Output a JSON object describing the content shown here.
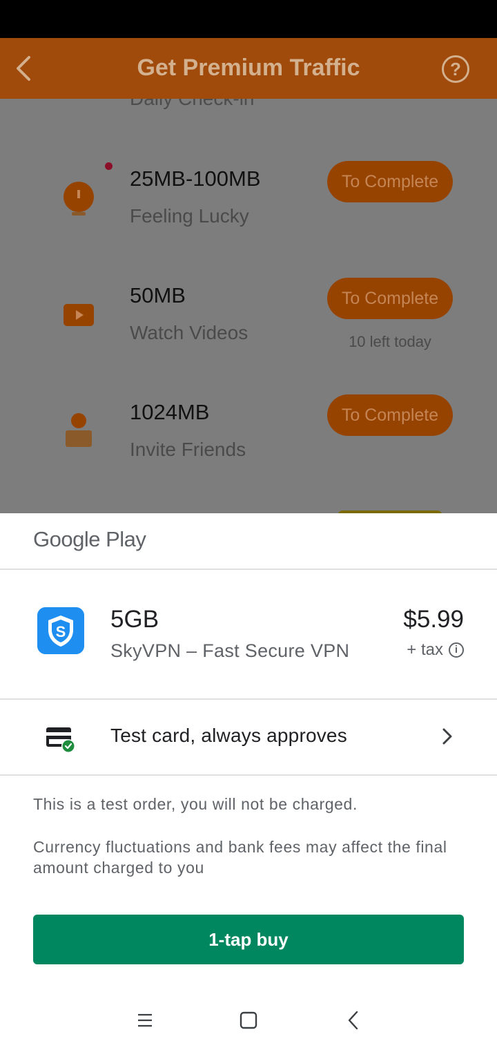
{
  "app": {
    "title": "Get Premium Traffic",
    "help_label": "?",
    "cut_off_section": "Daily Check-in",
    "tasks": [
      {
        "amount": "25MB-100MB",
        "description": "Feeling Lucky",
        "button": "To Complete",
        "note": ""
      },
      {
        "amount": "50MB",
        "description": "Watch Videos",
        "button": "To Complete",
        "note": "10 left today"
      },
      {
        "amount": "1024MB",
        "description": "Invite Friends",
        "button": "To Complete",
        "note": ""
      }
    ]
  },
  "sheet": {
    "brand": "Google Play",
    "product_name": "5GB",
    "product_app": "SkyVPN – Fast Secure VPN",
    "price": "$5.99",
    "tax": "+ tax",
    "payment_method": "Test card, always approves",
    "test_notice": "This is a test order, you will not be charged.",
    "currency_notice": "Currency fluctuations and bank fees may affect the final amount charged to you",
    "buy_label": "1-tap buy"
  },
  "colors": {
    "header_bg": "#a04a0c",
    "overlay_body": "#7d7d7d",
    "button_bg": "#964300",
    "buy_green": "#01875f",
    "app_icon_blue": "#1e8ff0"
  },
  "icons": {
    "back": "chevron-left-icon",
    "help": "question-circle-icon",
    "task1": "compass-icon",
    "task2": "video-icon",
    "task3": "person-icon",
    "product": "shield-s-icon",
    "payment": "credit-card-check-icon",
    "chevron": "chevron-right-icon",
    "info": "info-icon",
    "nav_menu": "menu-icon",
    "nav_home": "square-home-icon",
    "nav_back": "back-triangle-icon"
  }
}
